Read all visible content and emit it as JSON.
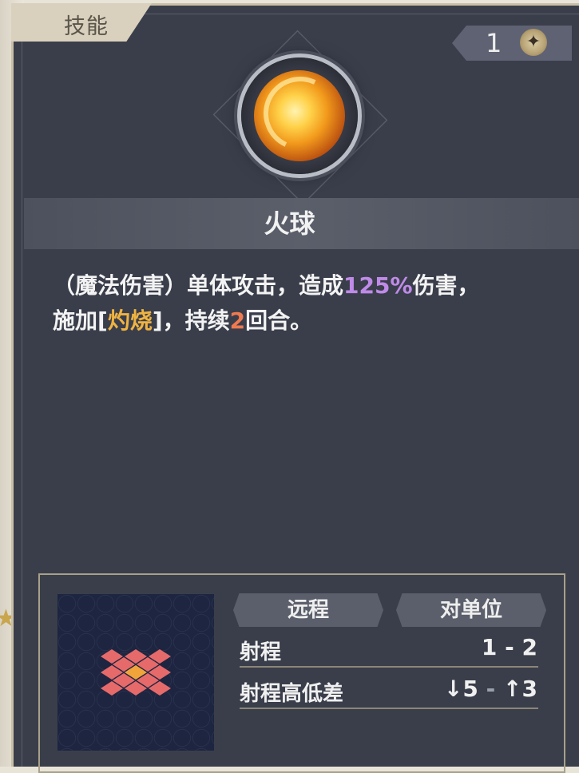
{
  "tab": {
    "label": "技能"
  },
  "cost": {
    "value": "1",
    "icon": "star-coin-icon"
  },
  "skill": {
    "name": "火球",
    "description": {
      "part1": "（魔法伤害）单体攻击，造成",
      "percent": "125%",
      "part2": "伤害，",
      "line2_prefix": "施加[",
      "status_effect": "灼烧",
      "line2_mid": "]，持续",
      "turns": "2",
      "line2_suffix": "回合。"
    }
  },
  "attack": {
    "type": "远程",
    "target": "对单位",
    "range_label": "射程",
    "range_value": "1 - 2",
    "height_label": "射程高低差",
    "height_down": "↓5",
    "height_sep": " - ",
    "height_up": "↑3"
  },
  "colors": {
    "percent": "#c08be8",
    "status": "#efb341",
    "turns": "#ee7a50",
    "tile": "#e66a6a",
    "center_tile": "#f0a43a"
  }
}
